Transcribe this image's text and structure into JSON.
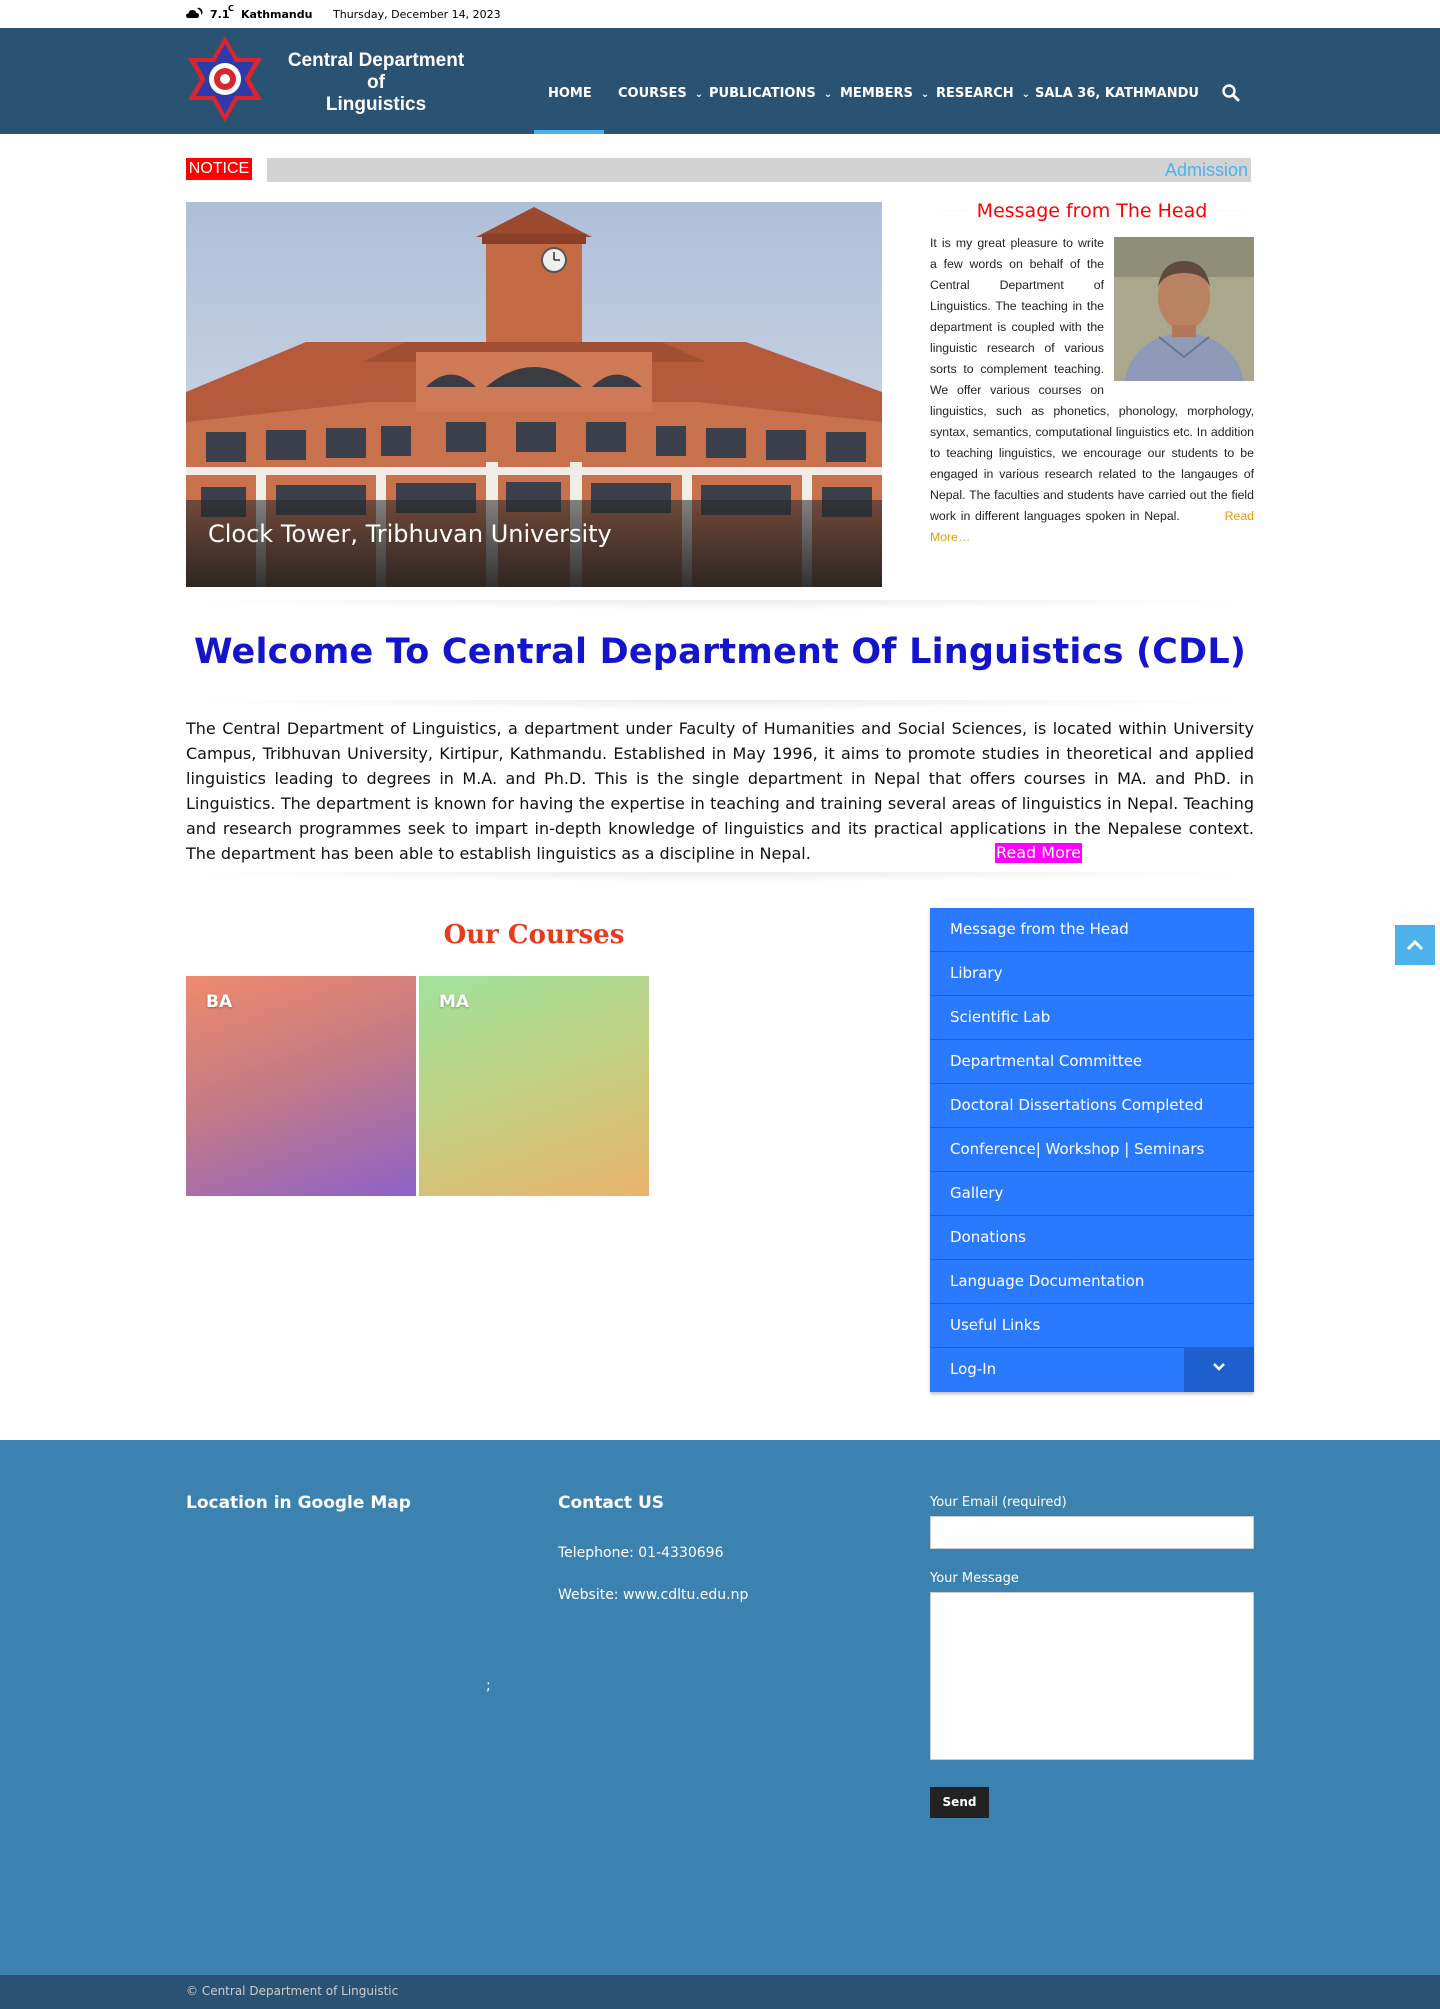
{
  "topbar": {
    "weather_icon": "cloud-moon-icon",
    "temperature": "7.1",
    "unit": "C",
    "city": "Kathmandu",
    "date": "Thursday, December 14, 2023"
  },
  "header": {
    "logo_icon": "tribhuvan-university-emblem",
    "site_title_line1": "Central Department",
    "site_title_line2": "of",
    "site_title_line3": "Linguistics",
    "nav": [
      {
        "label": "HOME",
        "has_dropdown": false
      },
      {
        "label": "COURSES",
        "has_dropdown": true
      },
      {
        "label": "PUBLICATIONS",
        "has_dropdown": true
      },
      {
        "label": "MEMBERS",
        "has_dropdown": true
      },
      {
        "label": "RESEARCH",
        "has_dropdown": true
      },
      {
        "label": "SALA 36, KATHMANDU",
        "has_dropdown": false
      }
    ],
    "active_nav": "HOME",
    "search_icon": "search-icon"
  },
  "notice": {
    "label": "NOTICE",
    "ticker_text": "Admission"
  },
  "slider": {
    "caption": "Clock Tower, Tribhuvan University"
  },
  "head_message": {
    "title": "Message from The Head",
    "body": "It is my great pleasure to write a few words on behalf of the Central Department of Linguistics. The teaching in the department is coupled with the linguistic research of various sorts to complement teaching. We offer various courses on linguistics, such as phonetics, phonology, morphology, syntax, semantics, computational linguistics etc. In addition to teaching linguistics, we encourage our students to be engaged in various research related to the langauges of Nepal. The faculties and students have carried out the field work in different languages spoken in Nepal.",
    "read_more": "Read More…"
  },
  "welcome": {
    "title": "Welcome To Central Department Of Linguistics  (CDL)",
    "body": "The Central Department of Linguistics, a department under Faculty of Humanities and Social Sciences, is located within University Campus, Tribhuvan University, Kirtipur, Kathmandu. Established in May 1996, it aims to promote studies in theoretical and applied linguistics leading to degrees in M.A. and Ph.D. This is the single department in Nepal that offers courses in MA. and PhD. in Linguistics. The department is known for having the expertise in teaching and training several areas of linguistics in Nepal. Teaching and research programmes seek to impart in-depth knowledge of linguistics and its practical applications in the Nepalese context. The department has been able to establish linguistics as a discipline in Nepal.",
    "read_more": "Read More"
  },
  "courses": {
    "title": "Our Courses",
    "items": [
      "BA",
      "MA"
    ]
  },
  "sidebar": {
    "items": [
      "Message from the Head",
      "Library",
      "Scientific Lab",
      "Departmental Committee",
      "Doctoral Dissertations Completed",
      "Conference| Workshop | Seminars",
      "Gallery",
      "Donations",
      "Language Documentation",
      "Useful Links",
      "Log-In"
    ]
  },
  "footer": {
    "map_heading": "Location in Google Map",
    "map_placeholder": ";",
    "contact_heading": "Contact US",
    "telephone": "Telephone: 01-4330696",
    "website_prefix": "Website: ",
    "website": "www.cdltu.edu.np",
    "email_label": "Your Email (required)",
    "message_label": "Your Message",
    "send_label": "Send",
    "copyright": "© Central Department of Linguistic"
  },
  "colors": {
    "header_bg": "#2a5373",
    "accent": "#4db2ec",
    "notice_red": "#ff0000",
    "welcome_blue": "#1414cc",
    "courses_title": "#e73b1a",
    "sidebar_blue": "#2a7aff",
    "footer_bg": "#3c82b1",
    "read_more_magenta": "#ff00ff"
  }
}
